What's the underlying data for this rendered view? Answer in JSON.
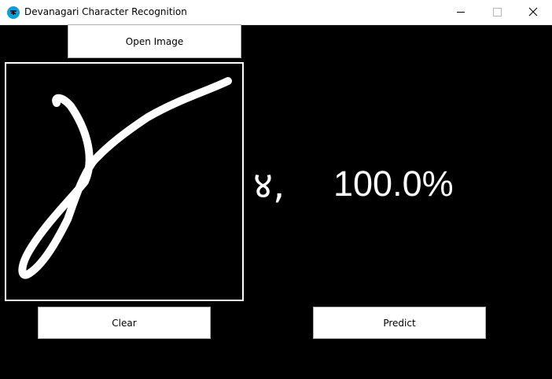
{
  "window": {
    "title": "Devanagari Character Recognition",
    "icon": "devanagari-app-icon",
    "controls": [
      "minimize-icon",
      "maximize-icon",
      "close-icon"
    ]
  },
  "buttons": {
    "open_image": "Open Image",
    "clear": "Clear",
    "predict": "Predict"
  },
  "prediction": {
    "character": "४,",
    "confidence": "100.0%"
  },
  "colors": {
    "background": "#000000",
    "stroke": "#ffffff",
    "button_bg": "#ffffff",
    "icon_accent": "#0d9fd8"
  }
}
